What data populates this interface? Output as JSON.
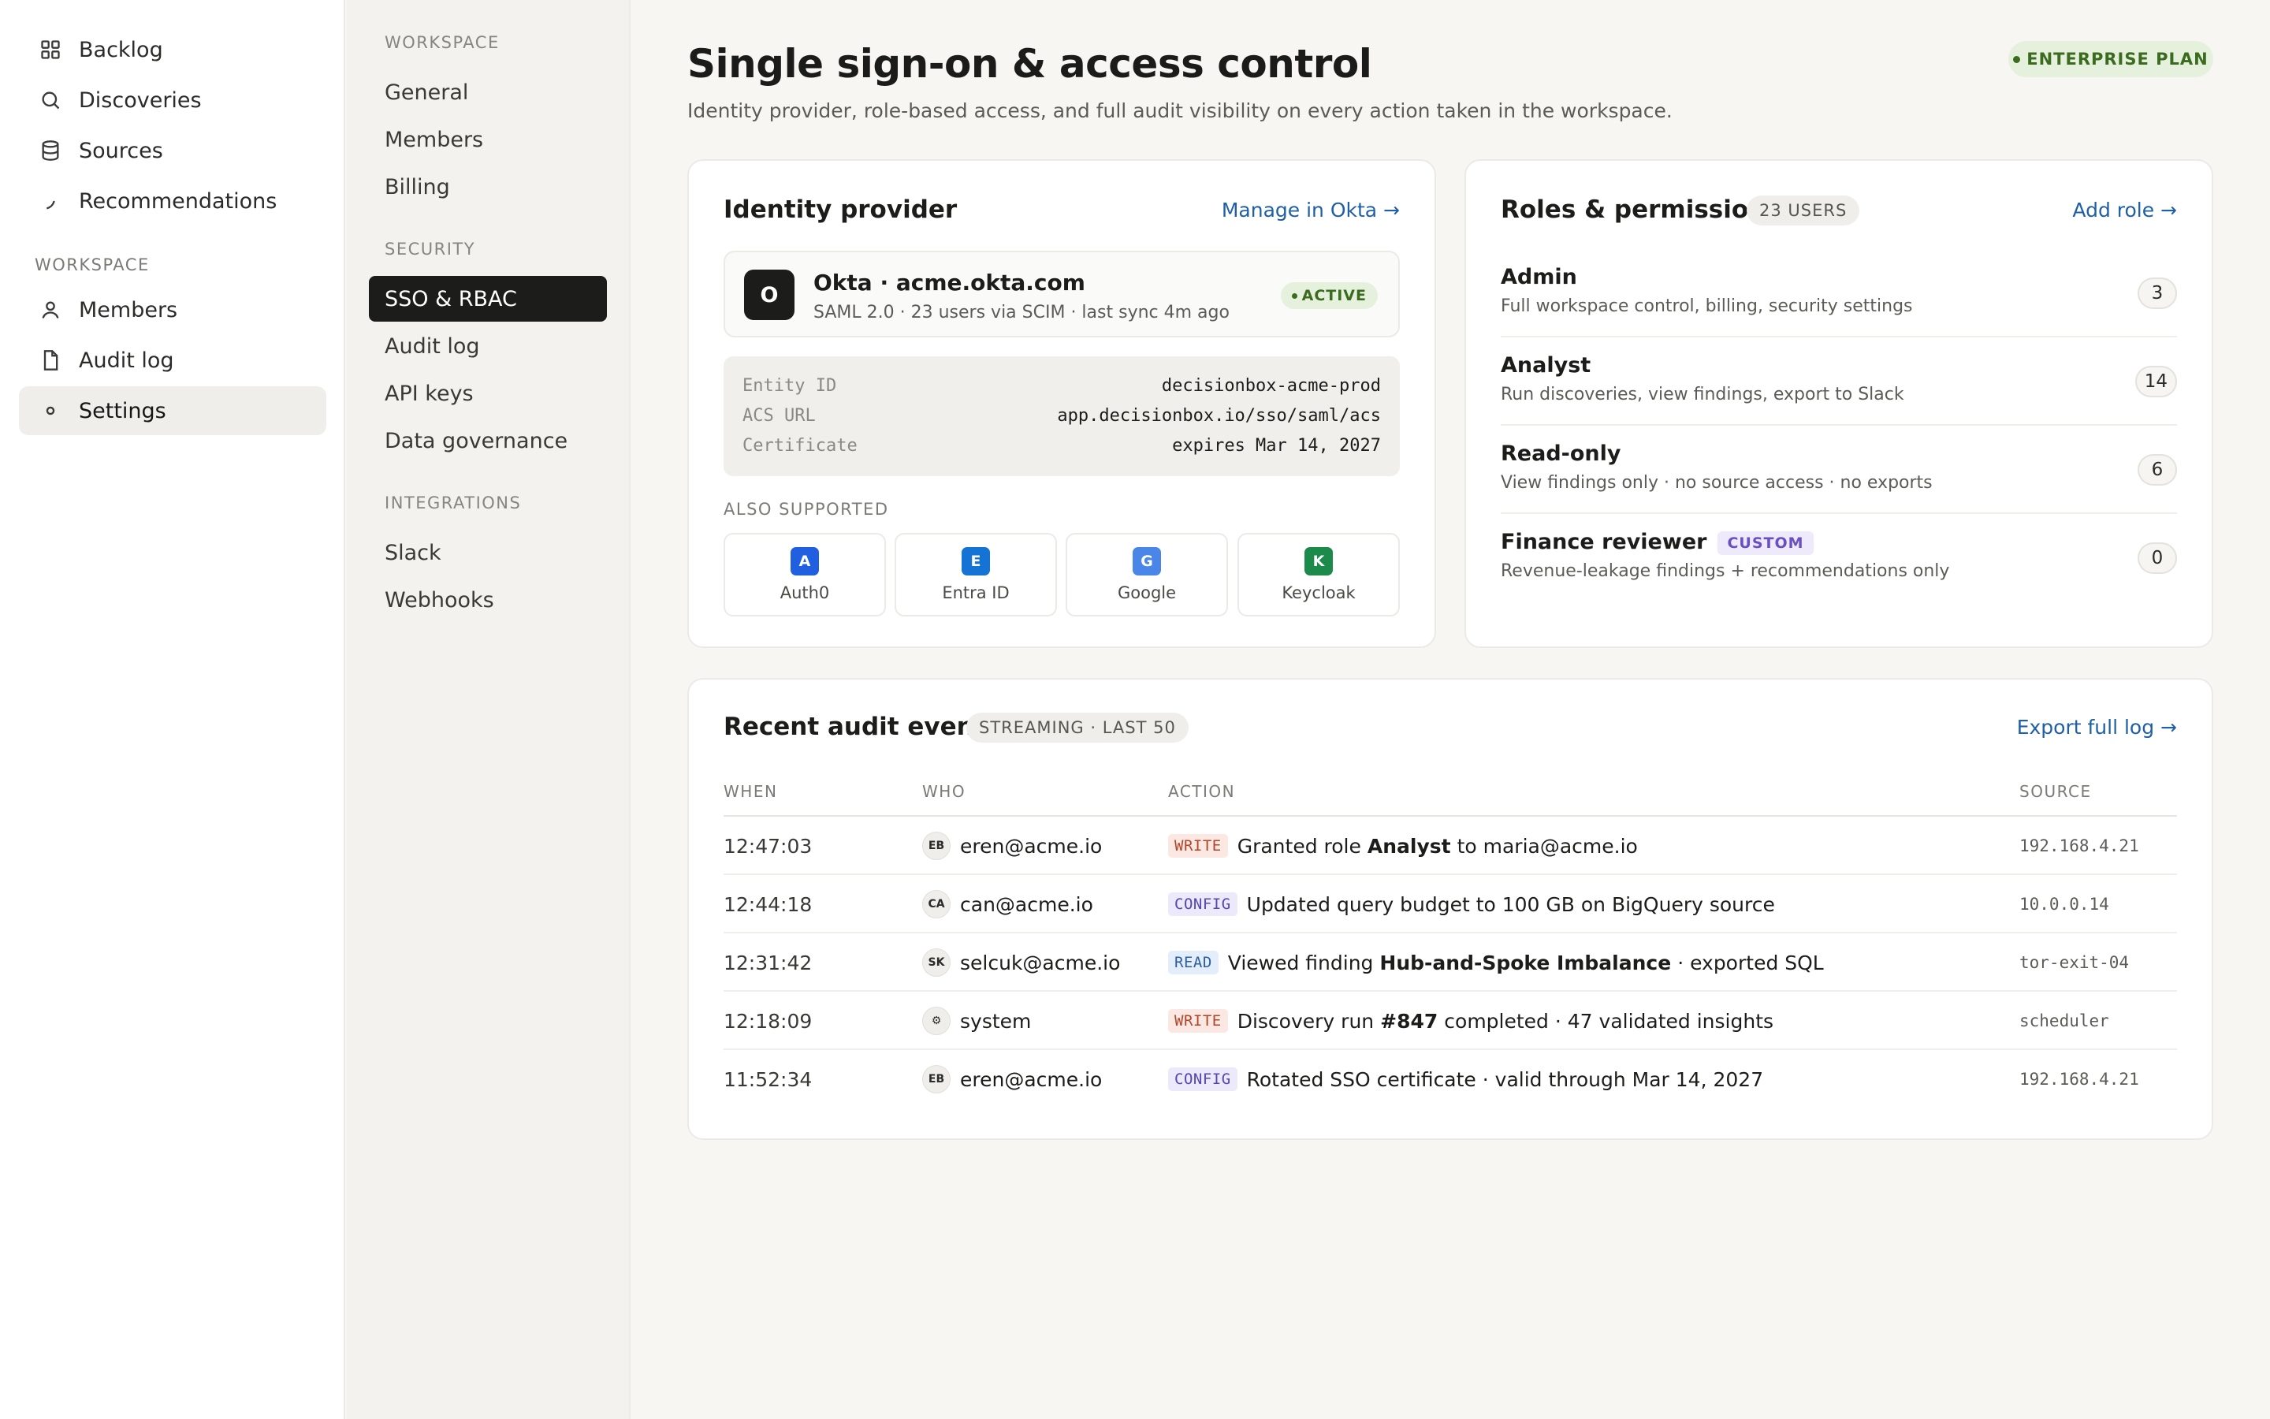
{
  "app_nav": {
    "items": [
      {
        "label": "Backlog",
        "icon": "grid-icon"
      },
      {
        "label": "Discoveries",
        "icon": "search-icon"
      },
      {
        "label": "Sources",
        "icon": "database-icon"
      },
      {
        "label": "Recommendations",
        "icon": "sparkle-icon"
      }
    ],
    "section_label": "WORKSPACE",
    "workspace_items": [
      {
        "label": "Members",
        "icon": "user-icon"
      },
      {
        "label": "Audit log",
        "icon": "file-icon"
      },
      {
        "label": "Settings",
        "icon": "dot-icon"
      }
    ]
  },
  "settings_nav": {
    "workspace_label": "WORKSPACE",
    "workspace_items": [
      "General",
      "Members",
      "Billing"
    ],
    "security_label": "SECURITY",
    "security_items": [
      "SSO & RBAC",
      "Audit log",
      "API keys",
      "Data governance"
    ],
    "integrations_label": "INTEGRATIONS",
    "integrations_items": [
      "Slack",
      "Webhooks"
    ]
  },
  "header": {
    "title": "Single sign-on & access control",
    "subtitle": "Identity provider, role-based access, and full audit visibility on every action taken in the workspace.",
    "plan_badge": "ENTERPRISE PLAN"
  },
  "identity_provider": {
    "title": "Identity provider",
    "manage_link": "Manage in Okta →",
    "provider": {
      "logo_letter": "O",
      "name": "Okta · acme.okta.com",
      "meta": "SAML 2.0 · 23 users via SCIM · last sync 4m ago",
      "status": "ACTIVE"
    },
    "fields": [
      {
        "key": "Entity ID",
        "value": "decisionbox-acme-prod"
      },
      {
        "key": "ACS URL",
        "value": "app.decisionbox.io/sso/saml/acs"
      },
      {
        "key": "Certificate",
        "value": "expires Mar 14, 2027"
      }
    ],
    "also_supported_label": "ALSO SUPPORTED",
    "also_supported": [
      {
        "letter": "A",
        "name": "Auth0",
        "color": "#1f5fe0"
      },
      {
        "letter": "E",
        "name": "Entra ID",
        "color": "#1473d4"
      },
      {
        "letter": "G",
        "name": "Google",
        "color": "#4a86e8"
      },
      {
        "letter": "K",
        "name": "Keycloak",
        "color": "#1b8a4a"
      }
    ]
  },
  "roles": {
    "title": "Roles & permissions",
    "user_count": "23 USERS",
    "add_link": "Add role →",
    "items": [
      {
        "name": "Admin",
        "desc": "Full workspace control, billing, security settings",
        "count": "3"
      },
      {
        "name": "Analyst",
        "desc": "Run discoveries, view findings, export to Slack",
        "count": "14"
      },
      {
        "name": "Read-only",
        "desc": "View findings only · no source access · no exports",
        "count": "6"
      },
      {
        "name": "Finance reviewer",
        "tag": "CUSTOM",
        "desc": "Revenue-leakage findings + recommendations only",
        "count": "0"
      }
    ]
  },
  "audit": {
    "title": "Recent audit events",
    "stream_badge": "STREAMING · LAST 50",
    "export_link": "Export full log →",
    "columns": [
      "WHEN",
      "WHO",
      "ACTION",
      "SOURCE"
    ],
    "rows": [
      {
        "when": "12:47:03",
        "initials": "EB",
        "who": "eren@acme.io",
        "tag": "WRITE",
        "pre": "Granted role",
        "bold": "Analyst",
        "post": "to maria@acme.io",
        "source": "192.168.4.21"
      },
      {
        "when": "12:44:18",
        "initials": "CA",
        "who": "can@acme.io",
        "tag": "CONFIG",
        "pre": "Updated query budget to 100 GB on BigQuery source",
        "bold": "",
        "post": "",
        "source": "10.0.0.14"
      },
      {
        "when": "12:31:42",
        "initials": "SK",
        "who": "selcuk@acme.io",
        "tag": "READ",
        "pre": "Viewed finding",
        "bold": "Hub-and-Spoke Imbalance",
        "post": "· exported SQL",
        "source": "tor-exit-04"
      },
      {
        "when": "12:18:09",
        "initials": "⚙",
        "who": "system",
        "tag": "WRITE",
        "pre": "Discovery run",
        "bold": "#847",
        "post": "completed · 47 validated insights",
        "source": "scheduler"
      },
      {
        "when": "11:52:34",
        "initials": "EB",
        "who": "eren@acme.io",
        "tag": "CONFIG",
        "pre": "Rotated SSO certificate · valid through Mar 14, 2027",
        "bold": "",
        "post": "",
        "source": "192.168.4.21"
      }
    ]
  }
}
